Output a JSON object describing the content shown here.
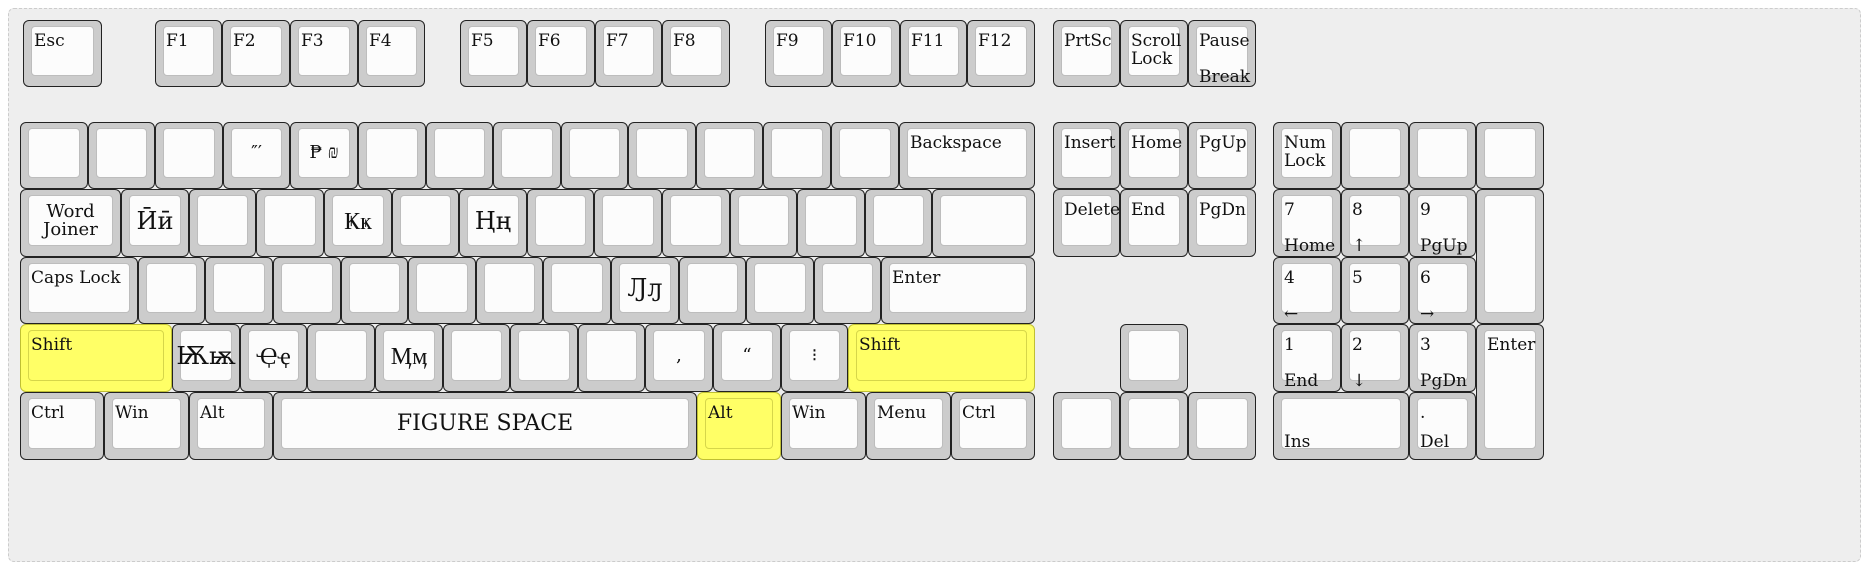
{
  "keys": {
    "esc": "Esc",
    "f1": "F1",
    "f2": "F2",
    "f3": "F3",
    "f4": "F4",
    "f5": "F5",
    "f6": "F6",
    "f7": "F7",
    "f8": "F8",
    "f9": "F9",
    "f10": "F10",
    "f11": "F11",
    "f12": "F12",
    "prtsc": "PrtSc",
    "scroll_lock": "Scroll\nLock",
    "pause": "Pause",
    "break": "Break",
    "num4": "″′",
    "num5": "₱ ₪",
    "backspace": "Backspace",
    "insert": "Insert",
    "home": "Home",
    "pgup": "PgUp",
    "num_lock": "Num\nLock",
    "word_joiner": "Word\nJoiner",
    "q_w": "Ӣӣ",
    "q_t": "Ҝҝ",
    "q_u": "Ңң",
    "delete": "Delete",
    "end": "End",
    "pgdn": "PgDn",
    "np7_top": "7",
    "np7_bottom": "Home",
    "np8_top": "8",
    "np8_bottom": "↑",
    "np9_top": "9",
    "np9_bottom": "PgUp",
    "caps_lock": "Caps Lock",
    "a_k": "Ԓԓ",
    "enter": "Enter",
    "np4_top": "4",
    "np4_bottom": "←",
    "np5_top": "5",
    "np6_top": "6",
    "np6_bottom": "→",
    "shift_left": "Shift",
    "z_1": "Ѭѭ",
    "z_2": "Ҿҿ",
    "z_4": "Ӎӎ",
    "comma": ",",
    "period": "“",
    "slash": "⁝",
    "shift_right": "Shift",
    "np1_top": "1",
    "np1_bottom": "End",
    "np2_top": "2",
    "np2_bottom": "↓",
    "np3_top": "3",
    "np3_bottom": "PgDn",
    "np_enter": "Enter",
    "ctrl_left": "Ctrl",
    "win_left": "Win",
    "alt_left": "Alt",
    "space": "FIGURE SPACE",
    "alt_right": "Alt",
    "win_right": "Win",
    "menu": "Menu",
    "ctrl_right": "Ctrl",
    "np0_bottom": "Ins",
    "npdot_top": ".",
    "npdot_bottom": "Del"
  },
  "colors": {
    "highlight": "#ffff66",
    "key_base": "#cccccc",
    "keycap": "#fcfcfc",
    "board": "#eeeeee"
  }
}
